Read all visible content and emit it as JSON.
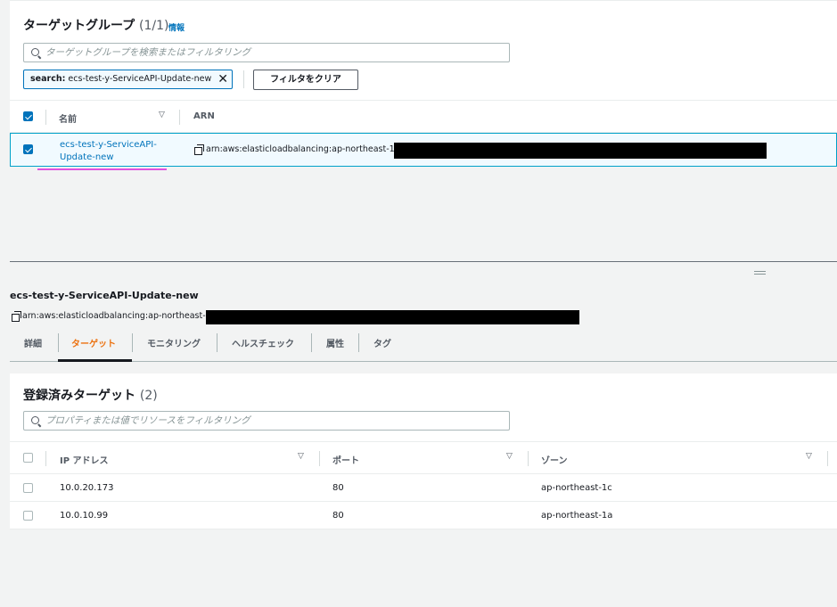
{
  "target_groups": {
    "title": "ターゲットグループ",
    "count": "(1/1)",
    "info_label": "情報",
    "search_placeholder": "ターゲットグループを検索またはフィルタリング",
    "filter_token": {
      "key": "search:",
      "value": "ecs-test-y-ServiceAPI-Update-new"
    },
    "clear_filter_label": "フィルタをクリア",
    "columns": {
      "name": "名前",
      "arn": "ARN"
    },
    "rows": [
      {
        "name_line1": "ecs-test-y-ServiceAPI-",
        "name_line2": "Update-new",
        "arn": "arn:aws:elasticloadbalancing:ap-northeast-1",
        "selected": true
      }
    ]
  },
  "detail": {
    "name": "ecs-test-y-ServiceAPI-Update-new",
    "arn": "arn:aws:elasticloadbalancing:ap-northeast-1"
  },
  "tabs": [
    {
      "label": "詳細",
      "active": false
    },
    {
      "label": "ターゲット",
      "active": true
    },
    {
      "label": "モニタリング",
      "active": false
    },
    {
      "label": "ヘルスチェック",
      "active": false
    },
    {
      "label": "属性",
      "active": false
    },
    {
      "label": "タグ",
      "active": false
    }
  ],
  "registered_targets": {
    "title": "登録済みターゲット",
    "count": "(2)",
    "search_placeholder": "プロパティまたは値でリソースをフィルタリング",
    "columns": {
      "ip": "IP アドレス",
      "port": "ポート",
      "zone": "ゾーン"
    },
    "rows": [
      {
        "ip": "10.0.20.173",
        "port": "80",
        "zone": "ap-northeast-1c"
      },
      {
        "ip": "10.0.10.99",
        "port": "80",
        "zone": "ap-northeast-1a"
      }
    ]
  },
  "colors": {
    "link": "#0073bb",
    "active_tab": "#ec7211",
    "selected_row_bg": "#f1faff",
    "redaction": "#000000"
  }
}
